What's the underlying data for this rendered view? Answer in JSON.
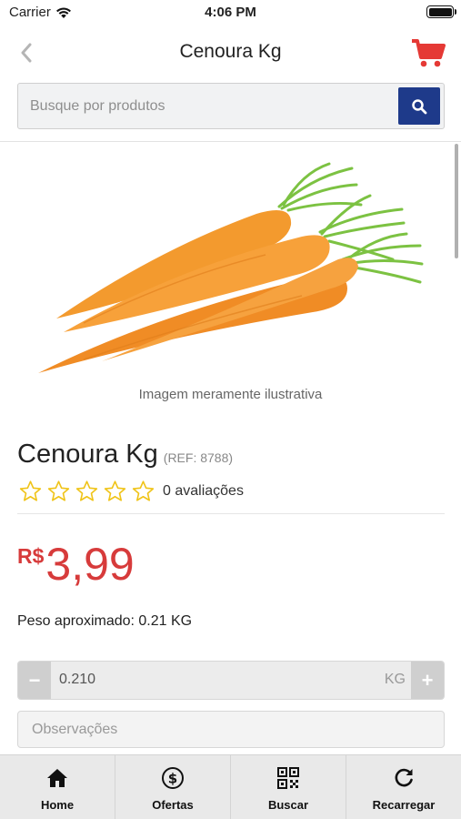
{
  "status": {
    "carrier": "Carrier",
    "time": "4:06 PM"
  },
  "nav": {
    "title": "Cenoura Kg",
    "back_icon": "chevron-left-icon",
    "cart_icon": "shopping-cart-icon"
  },
  "search": {
    "placeholder": "Busque por produtos",
    "value": "",
    "icon": "search-icon"
  },
  "product": {
    "image_caption": "Imagem meramente ilustrativa",
    "name": "Cenoura Kg",
    "ref": "(REF: 8788)",
    "rating_stars": 0,
    "rating_max": 5,
    "rating_count": "0 avaliações",
    "price_currency": "R$",
    "price_value": "3,99",
    "weight_info": "Peso aproximado: 0.21 KG"
  },
  "quantity": {
    "minus": "−",
    "value": "0.210",
    "unit": "KG",
    "plus": "+"
  },
  "observations": {
    "placeholder": "Observações",
    "value": ""
  },
  "tabs": [
    {
      "label": "Home",
      "icon": "home-icon"
    },
    {
      "label": "Ofertas",
      "icon": "dollar-icon"
    },
    {
      "label": "Buscar",
      "icon": "qr-code-icon"
    },
    {
      "label": "Recarregar",
      "icon": "refresh-icon"
    }
  ],
  "colors": {
    "accent_red": "#d73b3b",
    "search_button": "#1e3a8a",
    "star_outline": "#f0c419"
  }
}
